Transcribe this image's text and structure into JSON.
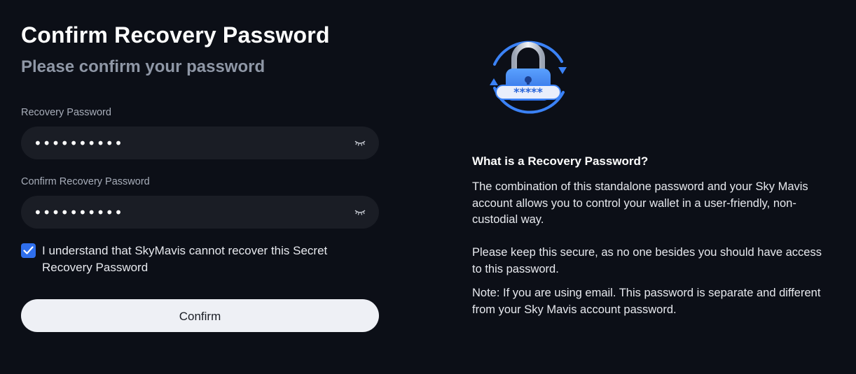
{
  "header": {
    "title": "Confirm Recovery Password",
    "subtitle": "Please confirm your password"
  },
  "form": {
    "password": {
      "label": "Recovery Password",
      "value": "••••••••••",
      "icon": "eye-closed-icon"
    },
    "confirm_password": {
      "label": "Confirm Recovery Password",
      "value": "••••••••••",
      "icon": "eye-closed-icon"
    },
    "acknowledge": {
      "checked": true,
      "text": "I understand that SkyMavis cannot recover this Secret Recovery Password"
    },
    "confirm_label": "Confirm"
  },
  "info": {
    "illustration": "lock-recovery-illustration",
    "title": "What is a Recovery Password?",
    "paragraph1": "The combination of this standalone password and your Sky Mavis account allows you to control your wallet in a user-friendly, non-custodial way.",
    "paragraph2": "Please keep this secure, as no one besides you should have access to this password.",
    "note": "Note: If you are using email. This password is separate and different from your Sky Mavis account password."
  },
  "colors": {
    "background": "#0c0f17",
    "field_bg": "#1a1d25",
    "accent": "#2f6fed",
    "button_bg": "#eef0f5"
  }
}
